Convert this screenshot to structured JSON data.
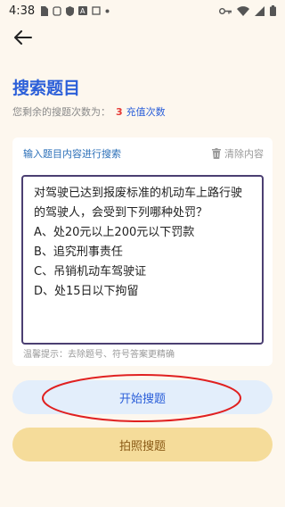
{
  "status_bar": {
    "time": "4:38",
    "icons_left": [
      "sim-icon",
      "notification-icon",
      "shield-icon",
      "a-icon",
      "app-icon",
      "dot-icon"
    ],
    "icons_right": [
      "key-icon",
      "wifi-icon",
      "signal-icon",
      "battery-icon"
    ]
  },
  "header": {
    "back_icon": "arrow-left-icon"
  },
  "page": {
    "title": "搜索题目",
    "remaining_label": "您剩余的搜题次数为：",
    "remaining_count": "3",
    "recharge_label": "充值次数"
  },
  "search_card": {
    "label": "输入题目内容进行搜索",
    "clear_label": "清除内容",
    "clear_icon": "trash-icon",
    "question_text": "对驾驶已达到报废标准的机动车上路行驶的驾驶人，会受到下列哪种处罚？\nA、处20元以上200元以下罚款\nB、追究刑事责任\nC、吊销机动车驾驶证\nD、处15日以下拘留",
    "tip": "温馨提示：去除题号、符号答案更精确"
  },
  "actions": {
    "start_search_label": "开始搜题",
    "photo_search_label": "拍照搜题"
  },
  "colors": {
    "accent_blue": "#2b5fd9",
    "count_red": "#e53935",
    "annotation_red": "#e02020",
    "photo_button_bg": "#f5dc9a",
    "start_button_bg": "#e3eefb"
  }
}
